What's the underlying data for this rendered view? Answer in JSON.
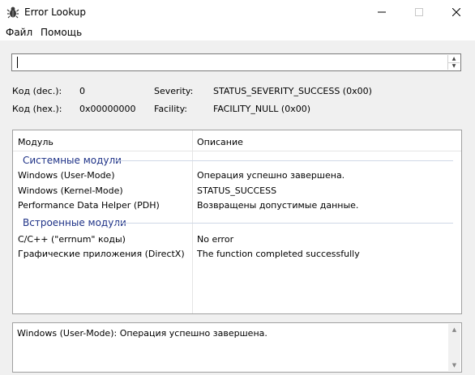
{
  "window": {
    "title": "Error Lookup"
  },
  "menu": {
    "file": "Файл",
    "help": "Помощь"
  },
  "search": {
    "value": ""
  },
  "info": {
    "dec_label": "Код (dec.):",
    "dec_value": "0",
    "hex_label": "Код (hex.):",
    "hex_value": "0x00000000",
    "severity_label": "Severity:",
    "severity_value": "STATUS_SEVERITY_SUCCESS (0x00)",
    "facility_label": "Facility:",
    "facility_value": "FACILITY_NULL (0x00)"
  },
  "results": {
    "columns": {
      "module": "Модуль",
      "description": "Описание"
    },
    "groups": [
      {
        "name": "Системные модули",
        "rows": [
          {
            "module": "Windows (User-Mode)",
            "description": "Операция успешно завершена."
          },
          {
            "module": "Windows (Kernel-Mode)",
            "description": "STATUS_SUCCESS"
          },
          {
            "module": "Performance Data Helper (PDH)",
            "description": "Возвращены допустимые данные."
          }
        ]
      },
      {
        "name": "Встроенные модули",
        "rows": [
          {
            "module": "C/C++ (\"errnum\" коды)",
            "description": "No error"
          },
          {
            "module": "Графические приложения (DirectX)",
            "description": "The function completed successfully"
          }
        ]
      }
    ]
  },
  "status": {
    "text": "Windows (User-Mode): Операция успешно завершена."
  },
  "icons": {
    "app": "bug-icon",
    "minimize": "minimize-icon",
    "maximize": "maximize-icon",
    "close": "close-icon"
  },
  "colors": {
    "group_header": "#1e3287"
  }
}
